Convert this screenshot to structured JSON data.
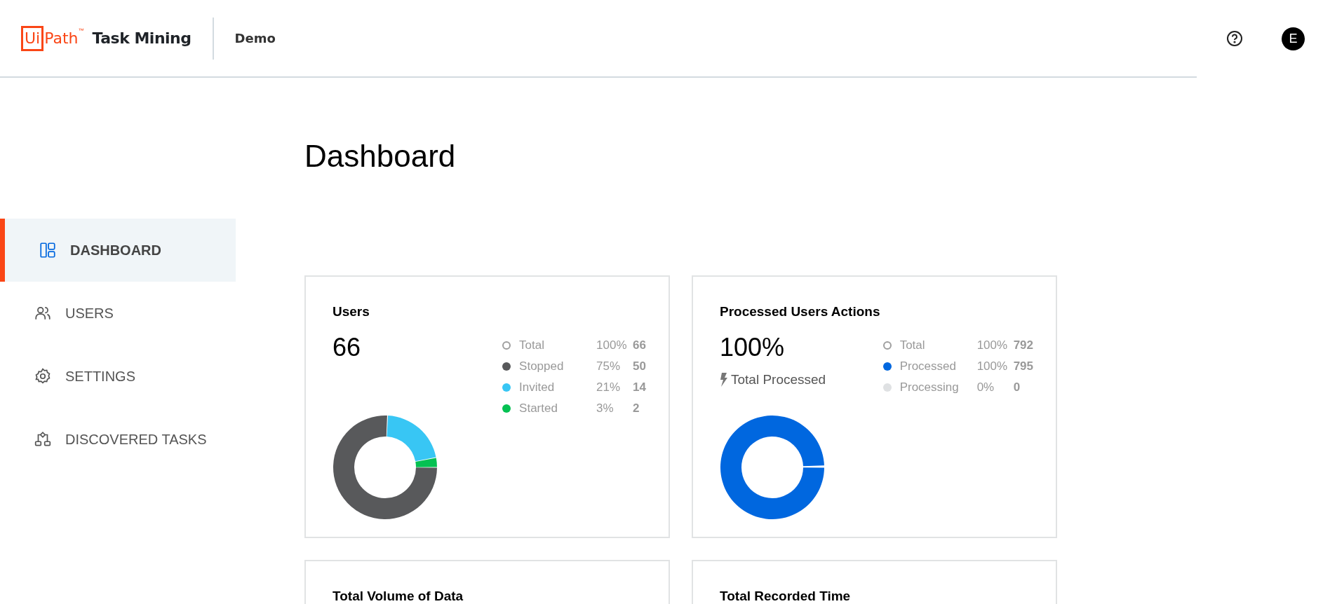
{
  "header": {
    "logo_box": "Ui",
    "logo_rest": "Path",
    "logo_mark": "™",
    "product": "Task Mining",
    "workspace": "Demo",
    "avatar": "E"
  },
  "sidebar": {
    "items": [
      {
        "label": "DASHBOARD",
        "selected": true
      },
      {
        "label": "USERS",
        "selected": false
      },
      {
        "label": "SETTINGS",
        "selected": false
      },
      {
        "label": "DISCOVERED TASKS",
        "selected": false
      }
    ]
  },
  "page_title": "Dashboard",
  "cards": [
    {
      "title": "Users",
      "value": "66",
      "legend": [
        {
          "kind": "outline",
          "label": "Total",
          "percent": "100%",
          "count": "66",
          "color": "#9e9e9e"
        },
        {
          "kind": "filled",
          "label": "Stopped",
          "percent": "75%",
          "count": "50",
          "color": "#58595b"
        },
        {
          "kind": "filled",
          "label": "Invited",
          "percent": "21%",
          "count": "14",
          "color": "#38c6f4"
        },
        {
          "kind": "filled",
          "label": "Started",
          "percent": "3%",
          "count": "2",
          "color": "#05c152"
        }
      ]
    },
    {
      "title": "Processed Users Actions",
      "value": "100%",
      "caption": "Total Processed",
      "legend": [
        {
          "kind": "outline",
          "label": "Total",
          "percent": "100%",
          "count": "792",
          "color": "#9e9e9e"
        },
        {
          "kind": "filled",
          "label": "Processed",
          "percent": "100%",
          "count": "795",
          "color": "#0067df"
        },
        {
          "kind": "filled",
          "label": "Processing",
          "percent": "0%",
          "count": "0",
          "color": "#dfe1e3"
        }
      ]
    },
    {
      "title": "Total Volume of Data"
    },
    {
      "title": "Total Recorded Time"
    }
  ]
}
